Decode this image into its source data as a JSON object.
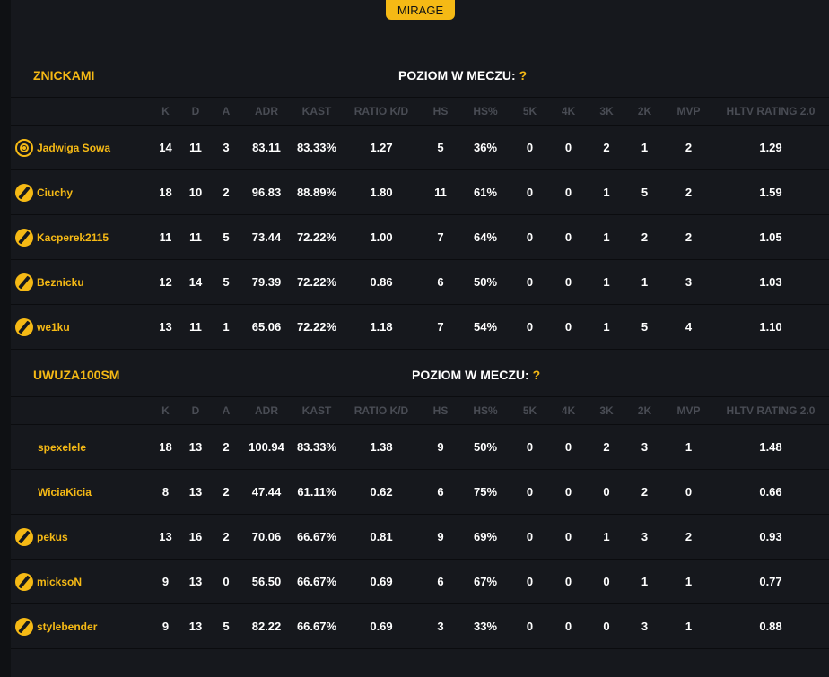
{
  "map_button": "MIRAGE",
  "columns": [
    "K",
    "D",
    "A",
    "ADR",
    "KAST",
    "RATIO K/D",
    "HS",
    "HS%",
    "5K",
    "4K",
    "3K",
    "2K",
    "MVP",
    "HLTV RATING 2.0"
  ],
  "level_label": "POZIOM W MECZU:",
  "level_value": "?",
  "teams": [
    {
      "name": "ZNICKAMI",
      "players": [
        {
          "name": "Jadwiga Sowa",
          "icon": "target-rank-icon",
          "stats": [
            "14",
            "11",
            "3",
            "83.11",
            "83.33%",
            "1.27",
            "5",
            "36%",
            "0",
            "0",
            "2",
            "1",
            "2",
            "1.29"
          ]
        },
        {
          "name": "Ciuchy",
          "icon": "pen-rank-icon",
          "stats": [
            "18",
            "10",
            "2",
            "96.83",
            "88.89%",
            "1.80",
            "11",
            "61%",
            "0",
            "0",
            "1",
            "5",
            "2",
            "1.59"
          ]
        },
        {
          "name": "Kacperek2115",
          "icon": "pen-rank-icon",
          "stats": [
            "11",
            "11",
            "5",
            "73.44",
            "72.22%",
            "1.00",
            "7",
            "64%",
            "0",
            "0",
            "1",
            "2",
            "2",
            "1.05"
          ]
        },
        {
          "name": "Beznicku",
          "icon": "pen-rank-icon",
          "stats": [
            "12",
            "14",
            "5",
            "79.39",
            "72.22%",
            "0.86",
            "6",
            "50%",
            "0",
            "0",
            "1",
            "1",
            "3",
            "1.03"
          ]
        },
        {
          "name": "we1ku",
          "icon": "pen-rank-icon",
          "stats": [
            "13",
            "11",
            "1",
            "65.06",
            "72.22%",
            "1.18",
            "7",
            "54%",
            "0",
            "0",
            "1",
            "5",
            "4",
            "1.10"
          ]
        }
      ]
    },
    {
      "name": "UWUZA100SM",
      "players": [
        {
          "name": "spexelele",
          "icon": "",
          "stats": [
            "18",
            "13",
            "2",
            "100.94",
            "83.33%",
            "1.38",
            "9",
            "50%",
            "0",
            "0",
            "2",
            "3",
            "1",
            "1.48"
          ]
        },
        {
          "name": "WiciaKicia",
          "icon": "",
          "stats": [
            "8",
            "13",
            "2",
            "47.44",
            "61.11%",
            "0.62",
            "6",
            "75%",
            "0",
            "0",
            "0",
            "2",
            "0",
            "0.66"
          ]
        },
        {
          "name": "pekus",
          "icon": "pen-rank-icon",
          "stats": [
            "13",
            "16",
            "2",
            "70.06",
            "66.67%",
            "0.81",
            "9",
            "69%",
            "0",
            "0",
            "1",
            "3",
            "2",
            "0.93"
          ]
        },
        {
          "name": "micksoN",
          "icon": "pen-rank-icon",
          "stats": [
            "9",
            "13",
            "0",
            "56.50",
            "66.67%",
            "0.69",
            "6",
            "67%",
            "0",
            "0",
            "0",
            "1",
            "1",
            "0.77"
          ]
        },
        {
          "name": "stylebender",
          "icon": "pen-rank-icon",
          "stats": [
            "9",
            "13",
            "5",
            "82.22",
            "66.67%",
            "0.69",
            "3",
            "33%",
            "0",
            "0",
            "0",
            "3",
            "1",
            "0.88"
          ]
        }
      ]
    }
  ]
}
